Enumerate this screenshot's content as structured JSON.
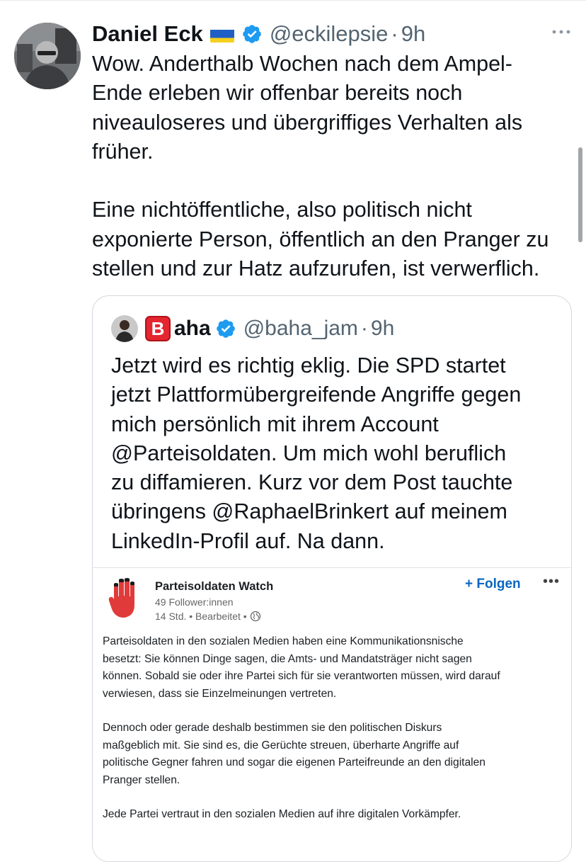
{
  "tweet": {
    "author_name": "Daniel Eck",
    "handle": "@eckilepsie",
    "separator": "·",
    "time": "9h",
    "text": "Wow. Anderthalb Wochen nach dem Ampel-\nEnde erleben wir offenbar bereits noch\nniveauloseres und übergriffiges Verhalten als\nfrüher.\n\nEine nichtöffentliche, also politisch nicht\nexponierte Person, öffentlich an den Pranger zu\nstellen und zur Hatz aufzurufen, ist verwerflich.",
    "more_icon": "more-horizontal-icon"
  },
  "quoted_tweet": {
    "name_badge": "B",
    "author_name": "aha",
    "handle": "@baha_jam",
    "separator": "·",
    "time": "9h",
    "text": "Jetzt wird es richtig eklig. Die SPD startet\njetzt Plattformübergreifende Angriffe gegen\nmich persönlich mit ihrem Account\n@Parteisoldaten. Um mich wohl beruflich\nzu diffamieren. Kurz vor dem Post tauchte\nübringens @RaphaelBrinkert auf meinem\nLinkedIn-Profil auf. Na dann."
  },
  "linkedin_post": {
    "org_name": "Parteisoldaten Watch",
    "followers": "49 Follower:innen",
    "meta": "14 Std. • Bearbeitet •",
    "follow_label": "+ Folgen",
    "more_label": "•••",
    "paragraphs": [
      "Parteisoldaten in den sozialen Medien haben eine Kommunikationsnische\nbesetzt: Sie können Dinge sagen, die Amts- und Mandatsträger nicht sagen\nkönnen. Sobald sie oder ihre Partei sich für sie verantworten müssen, wird darauf\nverwiesen, dass sie Einzelmeinungen vertreten.",
      "Dennoch oder gerade deshalb bestimmen sie den politischen Diskurs\nmaßgeblich mit. Sie sind es, die Gerüchte streuen, überharte Angriffe auf\npolitische Gegner fahren und sogar die eigenen Parteifreunde an den digitalen\nPranger stellen.",
      "Jede Partei vertraut in den sozialen Medien auf ihre digitalen Vorkämpfer."
    ]
  },
  "colors": {
    "verified_blue": "#1d9bf0",
    "secondary_text": "#536471",
    "linkedin_blue": "#0a66c2",
    "hand_red": "#e03a3a"
  }
}
